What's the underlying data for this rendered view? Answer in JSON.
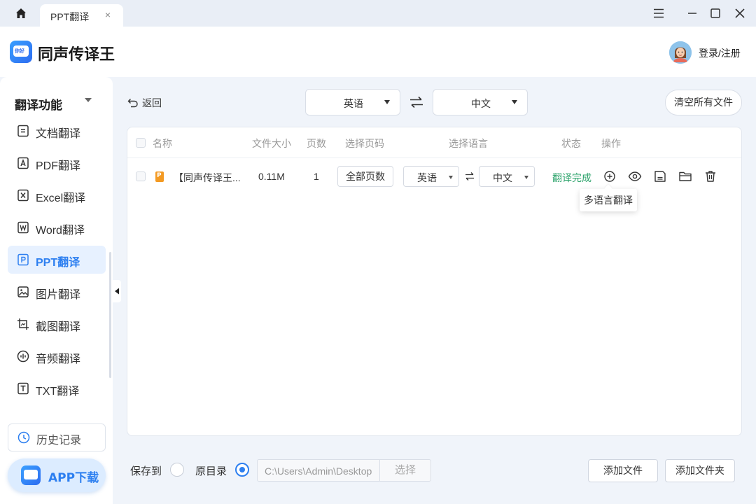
{
  "titlebar": {
    "tab_label": "PPT翻译",
    "tab_close": "×"
  },
  "header": {
    "app_name": "同声传译王",
    "login_label": "登录/注册"
  },
  "sidebar": {
    "heading": "翻译功能",
    "items": [
      {
        "label": "文档翻译",
        "icon": "document-icon",
        "active": false
      },
      {
        "label": "PDF翻译",
        "icon": "pdf-icon",
        "active": false
      },
      {
        "label": "Excel翻译",
        "icon": "excel-icon",
        "active": false
      },
      {
        "label": "Word翻译",
        "icon": "word-icon",
        "active": false
      },
      {
        "label": "PPT翻译",
        "icon": "ppt-icon",
        "active": true
      },
      {
        "label": "图片翻译",
        "icon": "image-icon",
        "active": false
      },
      {
        "label": "截图翻译",
        "icon": "screenshot-icon",
        "active": false
      },
      {
        "label": "音频翻译",
        "icon": "audio-icon",
        "active": false
      },
      {
        "label": "TXT翻译",
        "icon": "txt-icon",
        "active": false
      }
    ],
    "history_label": "历史记录",
    "app_download_label": "APP下载"
  },
  "toolbar": {
    "back_label": "返回",
    "source_lang": "英语",
    "target_lang": "中文",
    "clear_label": "清空所有文件"
  },
  "table": {
    "headers": {
      "name": "名称",
      "size": "文件大小",
      "pages": "页数",
      "page_select": "选择页码",
      "lang_select": "选择语言",
      "status": "状态",
      "ops": "操作"
    },
    "rows": [
      {
        "name": "【同声传译王...",
        "size": "0.11M",
        "pages": "1",
        "page_button": "全部页数",
        "source_lang": "英语",
        "target_lang": "中文",
        "status": "翻译完成"
      }
    ],
    "tooltip": "多语言翻译"
  },
  "bottom": {
    "save_to_label": "保存到",
    "original_dir_label": "原目录",
    "path_value": "C:\\Users\\Admin\\Desktop",
    "choose_label": "选择",
    "add_file_label": "添加文件",
    "add_folder_label": "添加文件夹"
  },
  "colors": {
    "accent": "#2d7ff0",
    "status_done": "#2ca36b",
    "file_orange": "#f39a23"
  }
}
